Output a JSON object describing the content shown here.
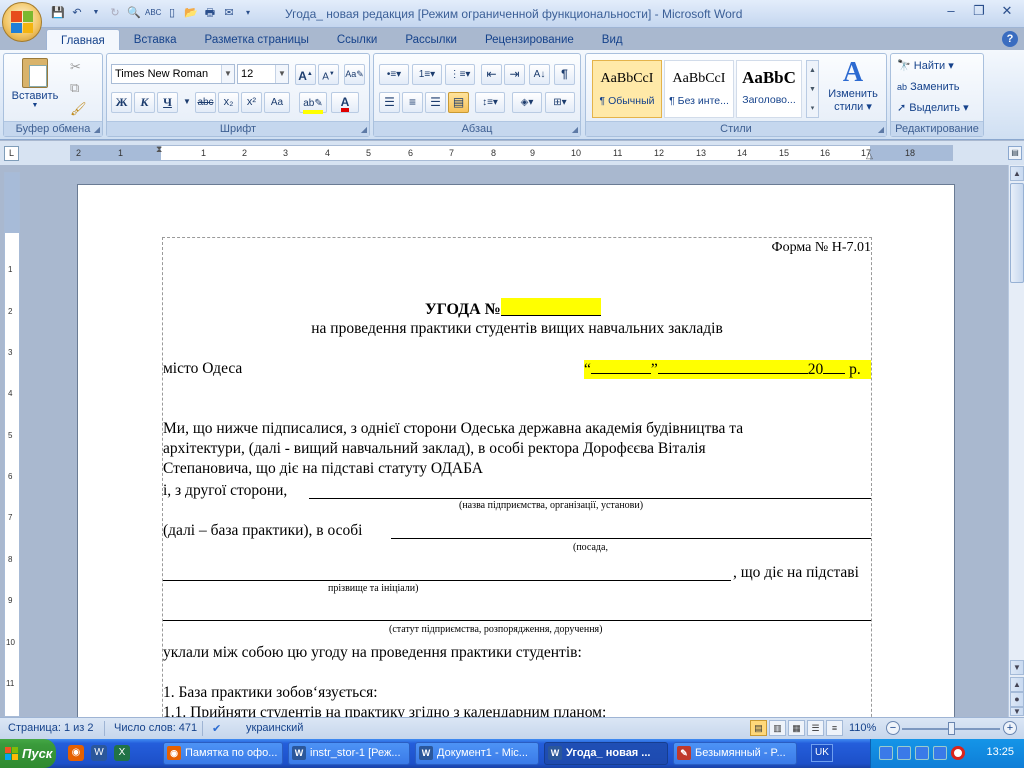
{
  "window": {
    "title": "Угода_ новая редакция [Режим ограниченной функциональности] - Microsoft Word"
  },
  "ribbon_tabs": [
    "Главная",
    "Вставка",
    "Разметка страницы",
    "Ссылки",
    "Рассылки",
    "Рецензирование",
    "Вид"
  ],
  "clipboard": {
    "paste_label": "Вставить",
    "group_label": "Буфер обмена"
  },
  "font": {
    "family": "Times New Roman",
    "size": "12",
    "group_label": "Шрифт",
    "bold": "Ж",
    "italic": "К",
    "underline": "Ч",
    "strike": "abc",
    "subscript": "x₂",
    "superscript": "x²",
    "case": "Aa",
    "grow": "A",
    "shrink": "A"
  },
  "paragraph": {
    "group_label": "Абзац",
    "pilcrow": "¶"
  },
  "styles": {
    "group_label": "Стили",
    "items": [
      {
        "sample": "AaBbCcI",
        "name": "¶ Обычный"
      },
      {
        "sample": "AaBbCcI",
        "name": "¶ Без инте..."
      },
      {
        "sample": "AaBbC",
        "name": "Заголово..."
      }
    ],
    "change_label": "Изменить",
    "change_label2": "стили"
  },
  "editing": {
    "group_label": "Редактирование",
    "find": "Найти",
    "replace": "Заменить",
    "select": "Выделить"
  },
  "ruler": {
    "marks": [
      "2",
      "1",
      "1",
      "2",
      "3",
      "4",
      "5",
      "6",
      "7",
      "8",
      "9",
      "10",
      "11",
      "12",
      "13",
      "14",
      "15",
      "16",
      "17",
      "18"
    ],
    "vmarks": [
      "1",
      "2",
      "3",
      "4",
      "5",
      "6",
      "7",
      "8",
      "9",
      "10",
      "11"
    ]
  },
  "document": {
    "form_no": "Форма № Н-7.01",
    "title": "УГОДА №",
    "subtitle": "на проведення практики студентів вищих навчальних закладів",
    "city": "місто Одеса",
    "date_open_quote": "“",
    "date_close_quote": "”",
    "date_year": "20",
    "date_suffix": "р.",
    "para1_l1": "Ми,   що  нижче підписалися, з однієї сторони Одеська державна академія будівництва та",
    "para1_l2": "архітектури,  (далі  -  вищий    навчальний  заклад),  в  особі  ректора  Дорофєєва  Віталія",
    "para1_l3": "Степановича, що діє на підставі статуту ОДАБА",
    "other_side": "і, з другої сторони,",
    "hint_org": "(назва підприємства, організації, установи)",
    "base_practice": "(далі – база практики), в особі",
    "hint_position": "(посада,",
    "acting_basis": ", що діє на підставі",
    "hint_name": "прізвище та ініціали)",
    "hint_statute": "(статут підприємства, розпорядження, доручення)",
    "agreed": "уклали між собою цю угоду на проведення практики студентів:",
    "item1": "1.   База практики зобов‘язується:",
    "item1_1": "1.1. Прийняти студентів на практику згідно з календарним планом:"
  },
  "status": {
    "page": "Страница: 1 из 2",
    "words": "Число слов: 471",
    "language": "украинский",
    "zoom": "110%"
  },
  "taskbar": {
    "start": "Пуск",
    "items": [
      {
        "label": "Памятка по офо...",
        "icon": "firefox",
        "color": "#e66000"
      },
      {
        "label": "instr_stor-1 [Реж...",
        "icon": "word",
        "color": "#2b579a"
      },
      {
        "label": "Документ1 - Mic...",
        "icon": "word",
        "color": "#2b579a"
      },
      {
        "label": "Угода_ новая ...",
        "icon": "word",
        "color": "#2b579a"
      },
      {
        "label": "Безымянный - P...",
        "icon": "paint",
        "color": "#c0392b"
      }
    ],
    "lang": "UK",
    "clock": "13:25"
  }
}
